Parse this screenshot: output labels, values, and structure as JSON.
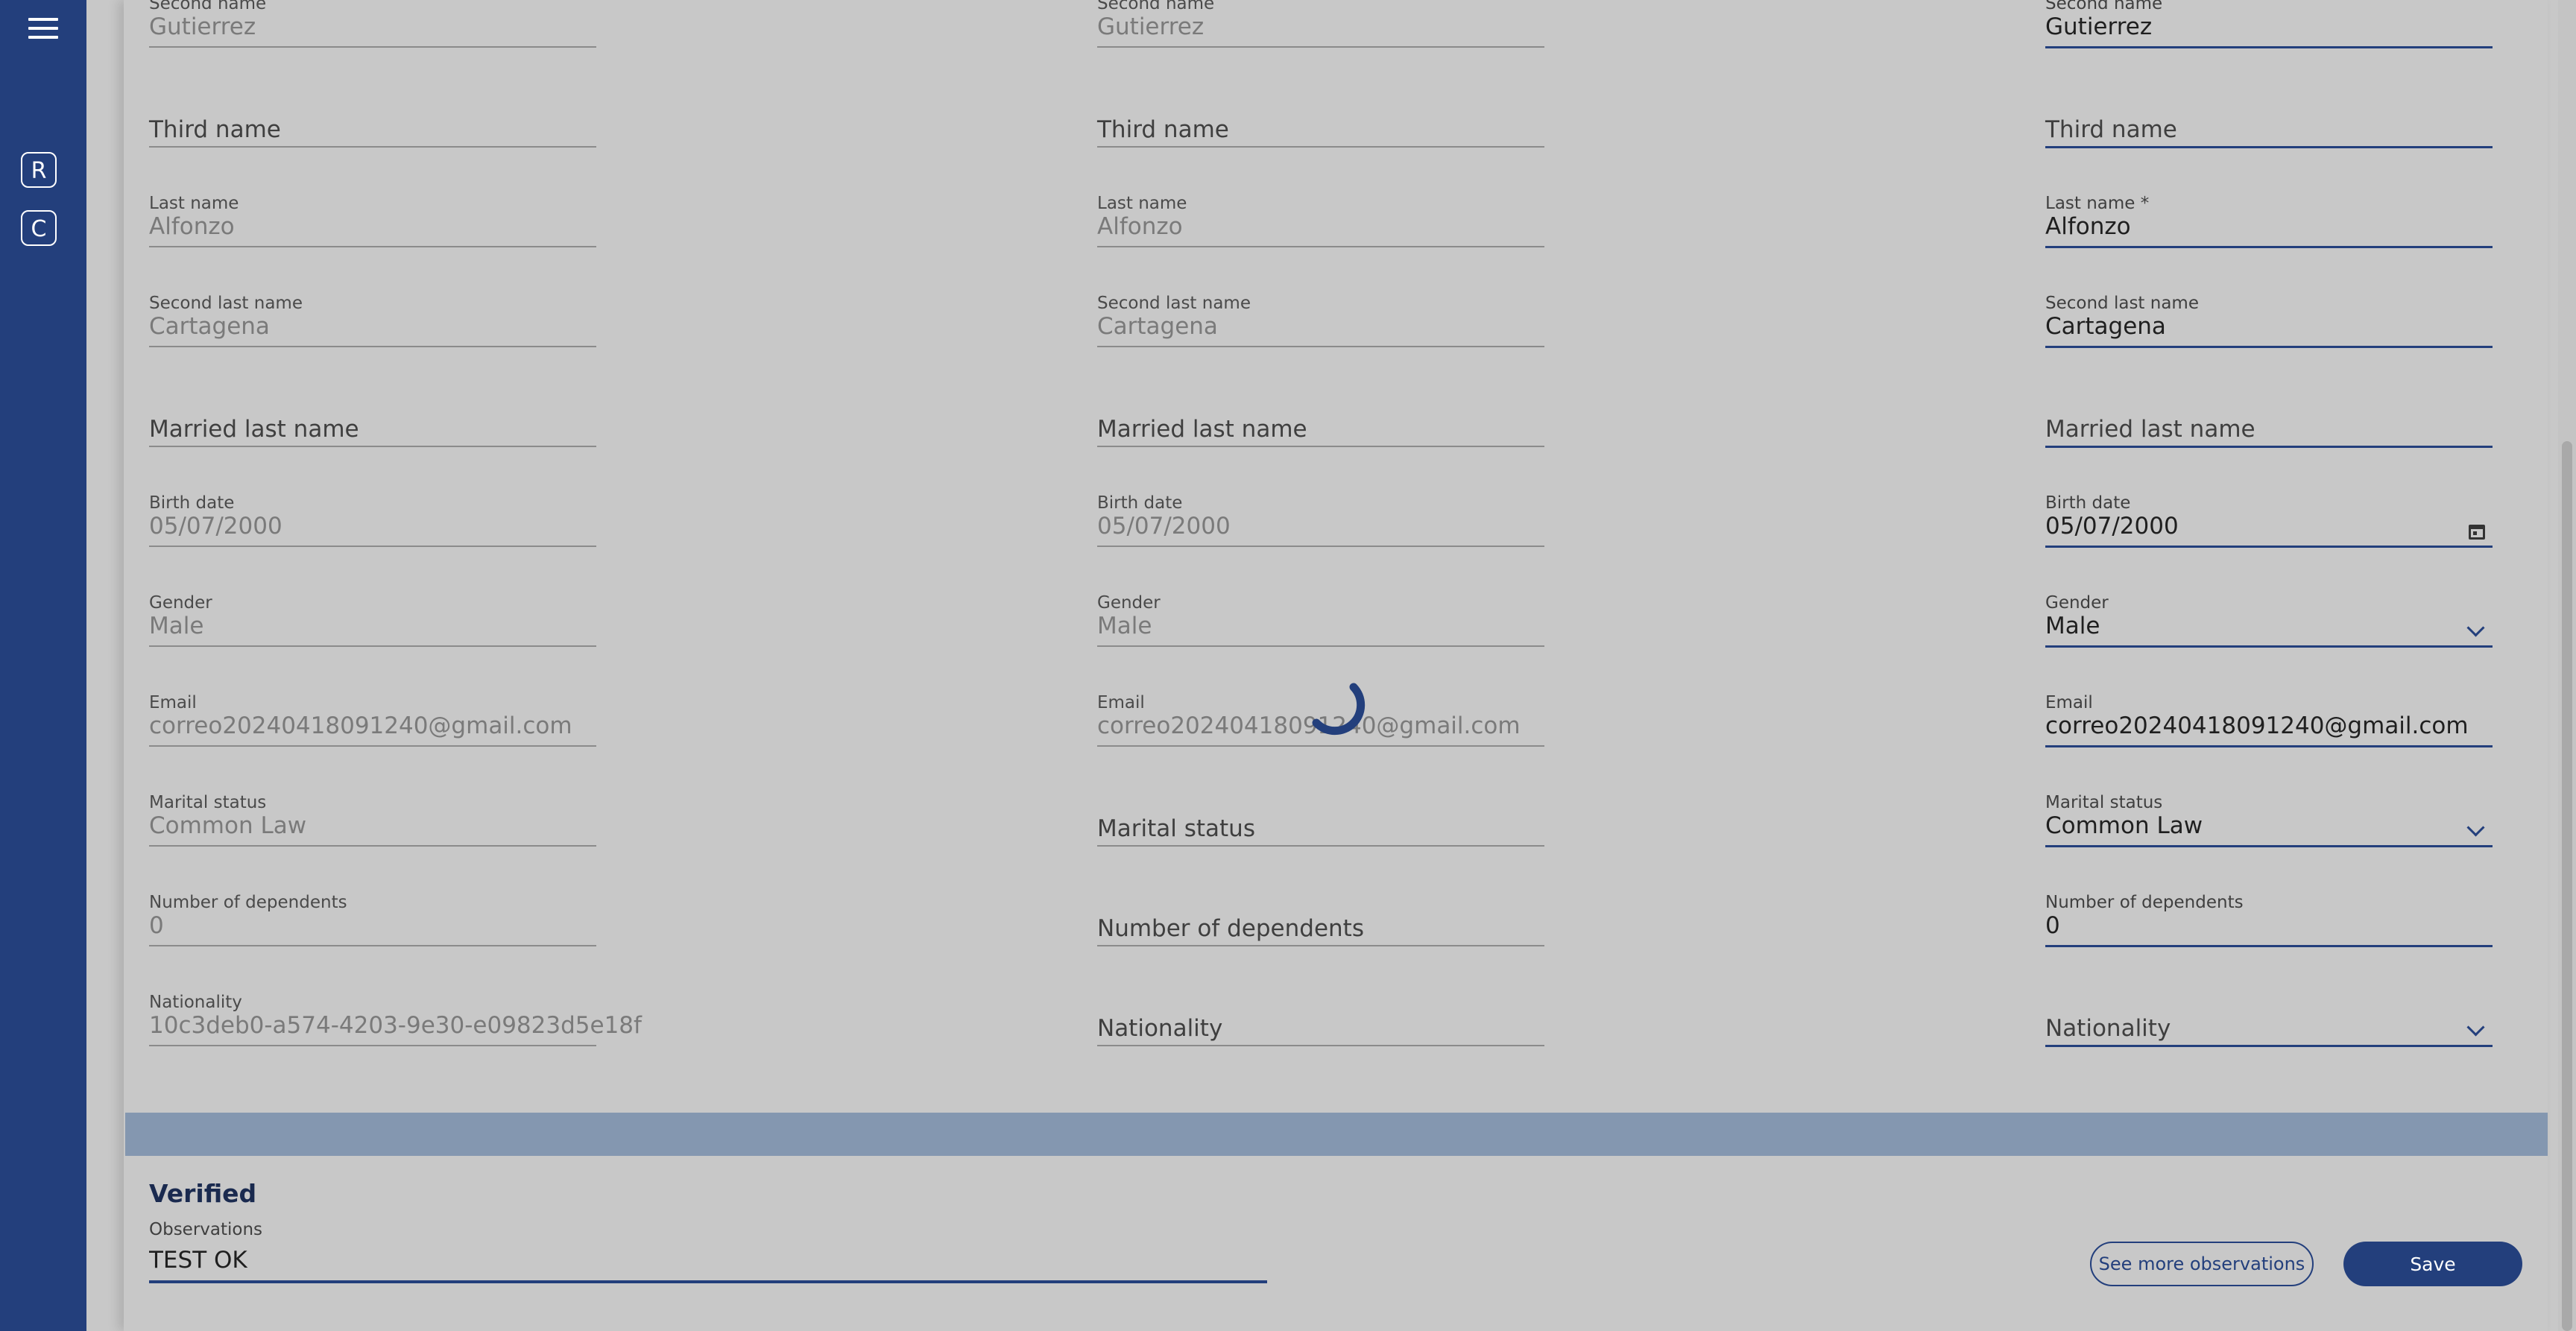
{
  "sidebar": {
    "menu_icon": "hamburger-menu-icon",
    "buttons": [
      {
        "label": "R"
      },
      {
        "label": "C"
      }
    ]
  },
  "columns": [
    {
      "fields": [
        {
          "label": "Second name",
          "value": "Gutierrez"
        },
        {
          "label": "",
          "value": "",
          "placeholder": "Third name"
        },
        {
          "label": "Last name",
          "value": "Alfonzo"
        },
        {
          "label": "Second last name",
          "value": "Cartagena"
        },
        {
          "label": "",
          "value": "",
          "placeholder": "Married last name"
        },
        {
          "label": "Birth date",
          "value": "05/07/2000"
        },
        {
          "label": "Gender",
          "value": "Male"
        },
        {
          "label": "Email",
          "value": "correo20240418091240@gmail.com"
        },
        {
          "label": "Marital status",
          "value": "Common Law"
        },
        {
          "label": "Number of dependents",
          "value": "0"
        },
        {
          "label": "Nationality",
          "value": "10c3deb0-a574-4203-9e30-e09823d5e18f"
        }
      ]
    },
    {
      "fields": [
        {
          "label": "Second name",
          "value": "Gutierrez"
        },
        {
          "label": "",
          "value": "",
          "placeholder": "Third name"
        },
        {
          "label": "Last name",
          "value": "Alfonzo"
        },
        {
          "label": "Second last name",
          "value": "Cartagena"
        },
        {
          "label": "",
          "value": "",
          "placeholder": "Married last name"
        },
        {
          "label": "Birth date",
          "value": "05/07/2000"
        },
        {
          "label": "Gender",
          "value": "Male"
        },
        {
          "label": "Email",
          "value": "correo20240418091240@gmail.com"
        },
        {
          "label": "",
          "value": "",
          "placeholder": "Marital status"
        },
        {
          "label": "",
          "value": "",
          "placeholder": "Number of dependents"
        },
        {
          "label": "",
          "value": "",
          "placeholder": "Nationality"
        }
      ]
    },
    {
      "fields": [
        {
          "label": "Second name",
          "value": "Gutierrez"
        },
        {
          "label": "",
          "value": "",
          "placeholder": "Third name"
        },
        {
          "label": "Last name *",
          "value": "Alfonzo"
        },
        {
          "label": "Second last name",
          "value": "Cartagena"
        },
        {
          "label": "",
          "value": "",
          "placeholder": "Married last name"
        },
        {
          "label": "Birth date",
          "value": "05/07/2000",
          "icon": "calendar-icon"
        },
        {
          "label": "Gender",
          "value": "Male",
          "icon": "chevron-down-icon"
        },
        {
          "label": "Email",
          "value": "correo20240418091240@gmail.com"
        },
        {
          "label": "Marital status",
          "value": "Common Law",
          "icon": "chevron-down-icon"
        },
        {
          "label": "Number of dependents",
          "value": "0"
        },
        {
          "label": "",
          "value": "",
          "placeholder": "Nationality",
          "icon": "chevron-down-icon"
        }
      ]
    }
  ],
  "footer": {
    "verified_title": "Verified",
    "observations_label": "Observations",
    "observations_value": "TEST OK",
    "see_more_label": "See more observations",
    "save_label": "Save"
  },
  "colors": {
    "primary": "#233f7c",
    "background": "#c8c8c8",
    "band": "#8497b0"
  }
}
